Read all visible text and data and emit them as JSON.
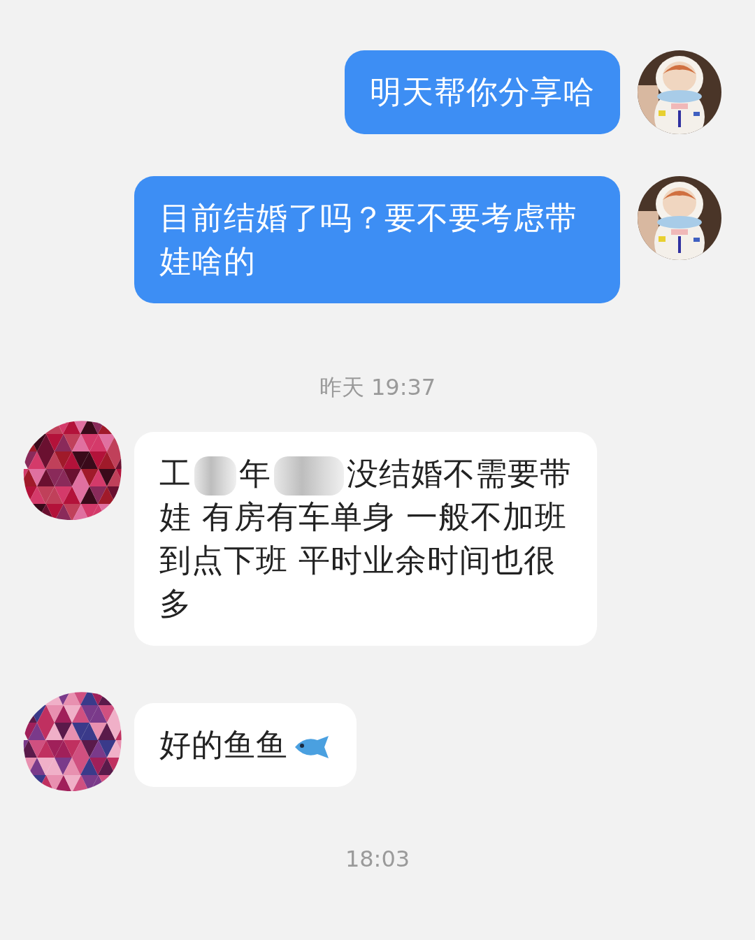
{
  "messages": [
    {
      "kind": "sent",
      "text": "明天帮你分享哈"
    },
    {
      "kind": "sent",
      "text": "目前结婚了吗？要不要考虑带娃啥的"
    },
    {
      "kind": "time",
      "text": "昨天 19:37"
    },
    {
      "kind": "received",
      "parts": [
        {
          "kind": "text",
          "text": "工"
        },
        {
          "kind": "redacted"
        },
        {
          "kind": "text",
          "text": "年"
        },
        {
          "kind": "redacted"
        },
        {
          "kind": "text",
          "text": "没结婚不需要带"
        },
        {
          "kind": "break"
        },
        {
          "kind": "text",
          "text": "娃 有房有车单身 一般不加班"
        },
        {
          "kind": "break"
        },
        {
          "kind": "text",
          "text": "到点下班 平时业余时间也很"
        },
        {
          "kind": "break"
        },
        {
          "kind": "text",
          "text": "多"
        }
      ]
    },
    {
      "kind": "received",
      "parts": [
        {
          "kind": "text",
          "text": "好的鱼鱼"
        },
        {
          "kind": "fish"
        }
      ]
    },
    {
      "kind": "time",
      "text": "18:03"
    }
  ]
}
